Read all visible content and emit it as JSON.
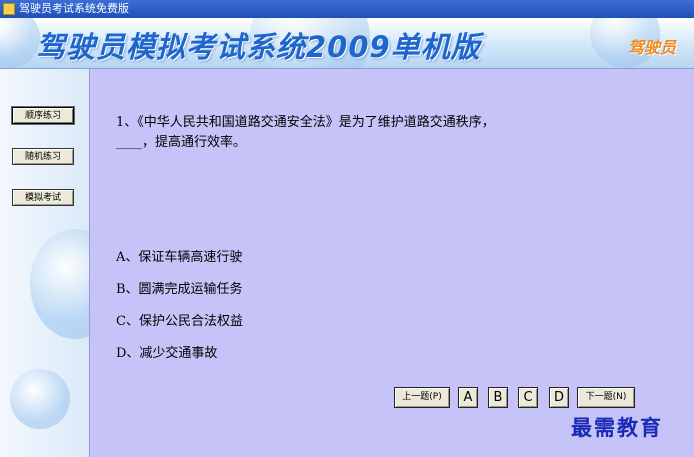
{
  "window": {
    "title": "驾驶员考试系统免费版"
  },
  "banner": {
    "title": "驾驶员模拟考试系统2009单机版",
    "right_title": "驾驶员"
  },
  "sidebar": {
    "items": [
      {
        "label": "顺序练习",
        "active": true
      },
      {
        "label": "随机练习",
        "active": false
      },
      {
        "label": "模拟考试",
        "active": false
      }
    ]
  },
  "question": {
    "line1": "1、《中华人民共和国道路交通安全法》是为了维护道路交通秩序，",
    "line2": "____，提高通行效率。",
    "options": [
      "A、保证车辆高速行驶",
      "B、圆满完成运输任务",
      "C、保护公民合法权益",
      "D、减少交通事故"
    ]
  },
  "controls": {
    "prev_label": "上一题(P)",
    "next_label": "下一题(N)",
    "answers": [
      "A",
      "B",
      "C",
      "D"
    ]
  },
  "watermark": "最需教育",
  "colors": {
    "main_bg": "#c6c3f8",
    "title_blue": "#1e66cc",
    "watermark": "#1a2ab8"
  }
}
